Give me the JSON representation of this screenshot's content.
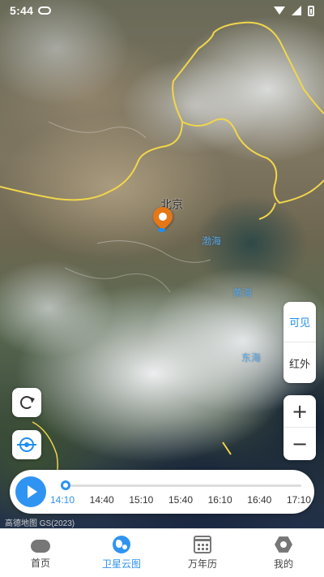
{
  "status_bar": {
    "time": "5:44",
    "icons": [
      "cloud-sync-icon",
      "wifi-icon",
      "signal-icon",
      "battery-icon"
    ]
  },
  "map": {
    "city_label": "北京",
    "sea_labels": [
      "渤海",
      "黄海",
      "东海"
    ],
    "marker_color": "#e67716",
    "attribution": "高德地图 GS(2023)"
  },
  "controls": {
    "refresh_icon": "refresh-icon",
    "locate_icon": "locate-icon",
    "layers": [
      {
        "label": "可见",
        "active": true
      },
      {
        "label": "红外",
        "active": false
      }
    ],
    "zoom_in_label": "+",
    "zoom_out_label": "−"
  },
  "timeline": {
    "playing": false,
    "times": [
      "14:10",
      "14:40",
      "15:10",
      "15:40",
      "16:10",
      "16:40",
      "17:10"
    ],
    "selected": "14:10",
    "progress": 0,
    "accent": "#2f93f2"
  },
  "bottom_nav": {
    "items": [
      {
        "label": "首页",
        "icon": "cloud-icon",
        "active": false
      },
      {
        "label": "卫星云图",
        "icon": "globe-icon",
        "active": true
      },
      {
        "label": "万年历",
        "icon": "calendar-icon",
        "active": false
      },
      {
        "label": "我的",
        "icon": "profile-hex-icon",
        "active": false
      }
    ]
  }
}
